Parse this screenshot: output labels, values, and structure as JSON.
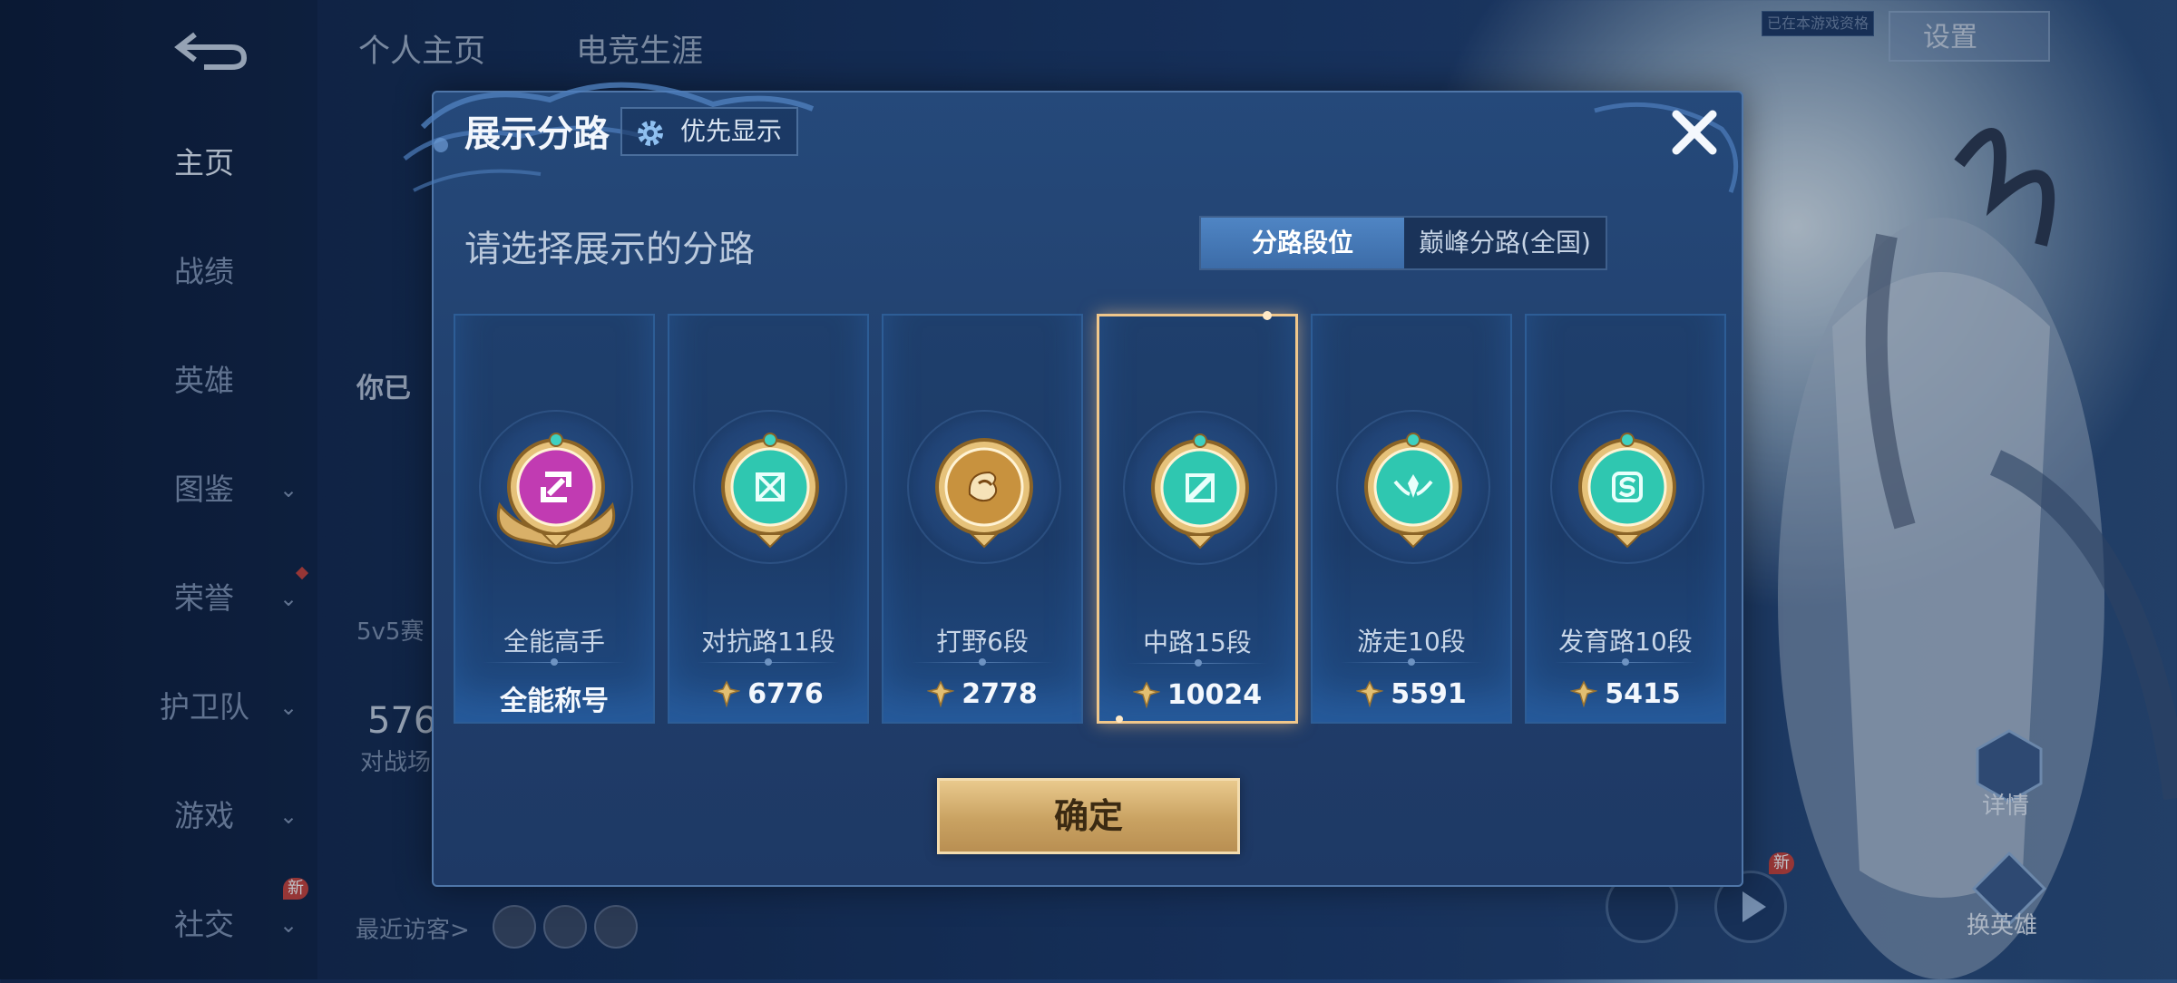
{
  "background": {
    "nav": [
      {
        "label": "主页",
        "active": true
      },
      {
        "label": "战绩"
      },
      {
        "label": "英雄"
      },
      {
        "label": "图鉴",
        "chevron": "⌄"
      },
      {
        "label": "荣誉",
        "chevron": "⌄"
      },
      {
        "label": "护卫队",
        "chevron": "⌄"
      },
      {
        "label": "游戏",
        "chevron": "⌄"
      },
      {
        "label": "社交",
        "chevron": "⌄",
        "badge": "新"
      }
    ],
    "tabs": [
      "个人主页",
      "电竞生涯"
    ],
    "settings_label": "设置",
    "chip_label": "已在本游戏资格",
    "profile_name_partial": "你已",
    "mode_text": "5v5赛",
    "stat_number": "576",
    "stat_label": "对战场",
    "recent_visitors": "最近访客>",
    "right_icon_1_label": "详情",
    "right_icon_2_label": "换英雄",
    "right_badge": "新"
  },
  "modal": {
    "title": "展示分路",
    "priority_button": "优先显示",
    "subtitle": "请选择展示的分路",
    "segment": {
      "active": "分路段位",
      "inactive": "巅峰分路(全国)"
    },
    "cards": [
      {
        "name": "全能高手",
        "score": "全能称号",
        "show_icon": false,
        "emblem": "all-round-emblem",
        "color": "#c13bb2"
      },
      {
        "name": "对抗路11段",
        "score": "6776",
        "show_icon": true,
        "emblem": "clash-lane-emblem",
        "color": "#2fc7b0"
      },
      {
        "name": "打野6段",
        "score": "2778",
        "show_icon": true,
        "emblem": "jungle-emblem",
        "color": "#c8923e"
      },
      {
        "name": "中路15段",
        "score": "10024",
        "show_icon": true,
        "emblem": "mid-lane-emblem",
        "color": "#2fc7b0",
        "selected": true
      },
      {
        "name": "游走10段",
        "score": "5591",
        "show_icon": true,
        "emblem": "roam-emblem",
        "color": "#2fc7b0"
      },
      {
        "name": "发育路10段",
        "score": "5415",
        "show_icon": true,
        "emblem": "farm-lane-emblem",
        "color": "#2fc7b0"
      }
    ],
    "confirm_button": "确定"
  }
}
